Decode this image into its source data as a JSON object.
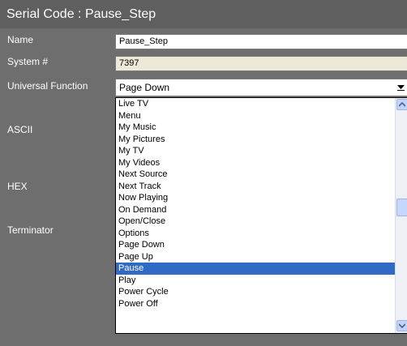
{
  "window": {
    "title": "Serial Code : Pause_Step"
  },
  "form": {
    "name_label": "Name",
    "name_value": "Pause_Step",
    "system_label": "System #",
    "system_value": "7397",
    "universal_label": "Universal Function",
    "universal_value": "Page Down",
    "ascii_label": "ASCII",
    "hex_label": "HEX",
    "terminator_label": "Terminator"
  },
  "dropdown": {
    "selected": "Pause",
    "items": [
      "Live TV",
      "Menu",
      "My Music",
      "My Pictures",
      "My TV",
      "My Videos",
      "Next Source",
      "Next Track",
      "Now Playing",
      "On Demand",
      "Open/Close",
      "Options",
      "Page Down",
      "Page Up",
      "Pause",
      "Play",
      "Power Cycle",
      "Power Off"
    ]
  },
  "colors": {
    "background": "#6e6e6e",
    "title_bar": "#5f5f5f",
    "selection": "#316ac5",
    "readonly_field": "#ece9d8"
  },
  "icons": {
    "dropdown_arrow": "chevron-down-icon",
    "scroll_up": "chevron-up-icon",
    "scroll_down": "chevron-down-icon"
  }
}
